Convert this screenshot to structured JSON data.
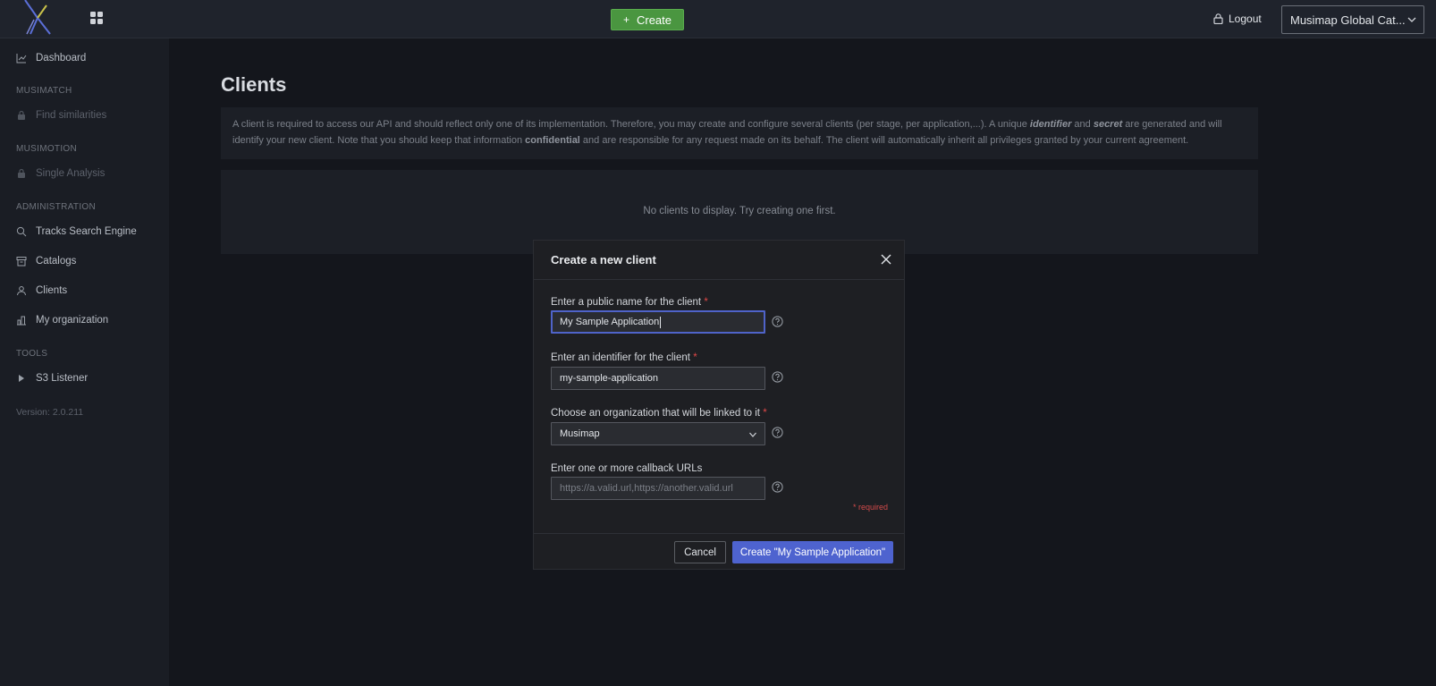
{
  "topbar": {
    "create_label": "Create",
    "create_icon": "plus-icon",
    "logout_label": "Logout",
    "catalog_label": "Musimap Global Cat..."
  },
  "sidebar": {
    "dashboard": "Dashboard",
    "section_musimatch": "MUSIMATCH",
    "find_similarities": "Find similarities",
    "section_musimotion": "MUSIMOTION",
    "single_analysis": "Single Analysis",
    "section_administration": "ADMINISTRATION",
    "tracks_search_engine": "Tracks Search Engine",
    "catalogs": "Catalogs",
    "clients": "Clients",
    "my_organization": "My organization",
    "section_tools": "TOOLS",
    "s3_listener": "S3 Listener",
    "version": "Version: 2.0.211"
  },
  "main": {
    "title": "Clients",
    "info_part1": "A client is required to access our API and should reflect only one of its implementation. Therefore, you may create and configure several clients (per stage, per application,...). A unique ",
    "info_identifier": "identifier",
    "info_and": " and ",
    "info_secret": "secret",
    "info_part2": " are generated and will identify your new client. Note that you should keep that information ",
    "info_confidential": "confidential",
    "info_part3": " and are responsible for any request made on its behalf. The client will automatically inherit all privileges granted by your current agreement.",
    "empty_text": "No clients to display. Try creating one first."
  },
  "modal": {
    "title": "Create a new client",
    "name_label": "Enter a public name for the client",
    "name_value": "My Sample Application",
    "identifier_label": "Enter an identifier for the client",
    "identifier_value": "my-sample-application",
    "organization_label": "Choose an organization that will be linked to it",
    "organization_value": "Musimap",
    "callback_label": "Enter one or more callback URLs",
    "callback_placeholder": "https://a.valid.url,https://another.valid.url",
    "required_marker": "*",
    "required_note": "* required",
    "cancel_label": "Cancel",
    "submit_label": "Create \"My Sample Application\""
  },
  "colors": {
    "accent": "#4e63cf",
    "create_green": "#4a9640",
    "required_red": "#e04848"
  }
}
